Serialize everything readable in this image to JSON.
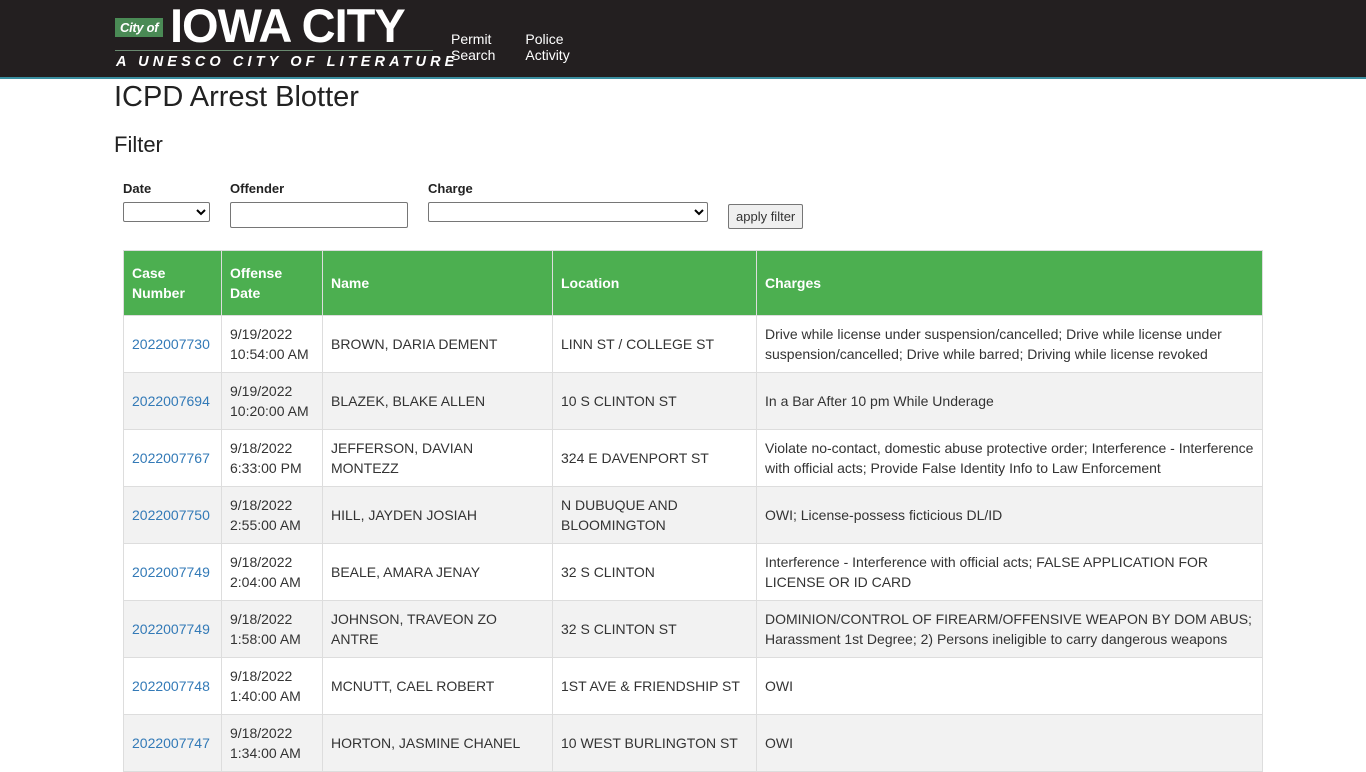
{
  "header": {
    "logo": {
      "city_of": "City of",
      "city_name": "IOWA CITY",
      "tagline": "A UNESCO CITY OF LITERATURE"
    },
    "nav": [
      {
        "label": "Permit Search"
      },
      {
        "label": "Police Activity"
      }
    ]
  },
  "page": {
    "title": "ICPD Arrest Blotter",
    "filter_heading": "Filter"
  },
  "filters": {
    "date_label": "Date",
    "date_value": "",
    "offender_label": "Offender",
    "offender_value": "",
    "offender_placeholder": "",
    "charge_label": "Charge",
    "charge_value": "",
    "apply_label": "apply filter"
  },
  "table": {
    "header_color": "#4caf50",
    "link_color": "#337ab7",
    "columns": [
      "Case Number",
      "Offense Date",
      "Name",
      "Location",
      "Charges"
    ],
    "rows": [
      {
        "case": "2022007730",
        "date": "9/19/2022",
        "time": "10:54:00 AM",
        "name": "BROWN, DARIA DEMENT",
        "location": "LINN ST / COLLEGE ST",
        "charges": "Drive while license under suspension/cancelled; Drive while license under suspension/cancelled; Drive while barred; Driving while license revoked"
      },
      {
        "case": "2022007694",
        "date": "9/19/2022",
        "time": "10:20:00 AM",
        "name": "BLAZEK, BLAKE ALLEN",
        "location": "10 S CLINTON ST",
        "charges": "In a Bar After 10 pm While Underage"
      },
      {
        "case": "2022007767",
        "date": "9/18/2022",
        "time": "6:33:00 PM",
        "name": "JEFFERSON, DAVIAN MONTEZZ",
        "location": "324 E DAVENPORT ST",
        "charges": "Violate no-contact, domestic abuse protective order; Interference - Interference with official acts; Provide False Identity Info to Law Enforcement"
      },
      {
        "case": "2022007750",
        "date": "9/18/2022",
        "time": "2:55:00 AM",
        "name": "HILL, JAYDEN JOSIAH",
        "location": "N DUBUQUE AND BLOOMINGTON",
        "charges": "OWI; License-possess ficticious DL/ID"
      },
      {
        "case": "2022007749",
        "date": "9/18/2022",
        "time": "2:04:00 AM",
        "name": "BEALE, AMARA JENAY",
        "location": "32 S CLINTON",
        "charges": "Interference - Interference with official acts; FALSE APPLICATION FOR LICENSE OR ID CARD"
      },
      {
        "case": "2022007749",
        "date": "9/18/2022",
        "time": "1:58:00 AM",
        "name": "JOHNSON, TRAVEON ZO ANTRE",
        "location": "32 S CLINTON ST",
        "charges": "DOMINION/CONTROL OF FIREARM/OFFENSIVE WEAPON BY DOM ABUS; Harassment 1st Degree; 2) Persons ineligible to carry dangerous weapons"
      },
      {
        "case": "2022007748",
        "date": "9/18/2022",
        "time": "1:40:00 AM",
        "name": "MCNUTT, CAEL ROBERT",
        "location": "1ST AVE & FRIENDSHIP ST",
        "charges": "OWI"
      },
      {
        "case": "2022007747",
        "date": "9/18/2022",
        "time": "1:34:00 AM",
        "name": "HORTON, JASMINE CHANEL",
        "location": "10 WEST BURLINGTON ST",
        "charges": "OWI"
      }
    ]
  }
}
